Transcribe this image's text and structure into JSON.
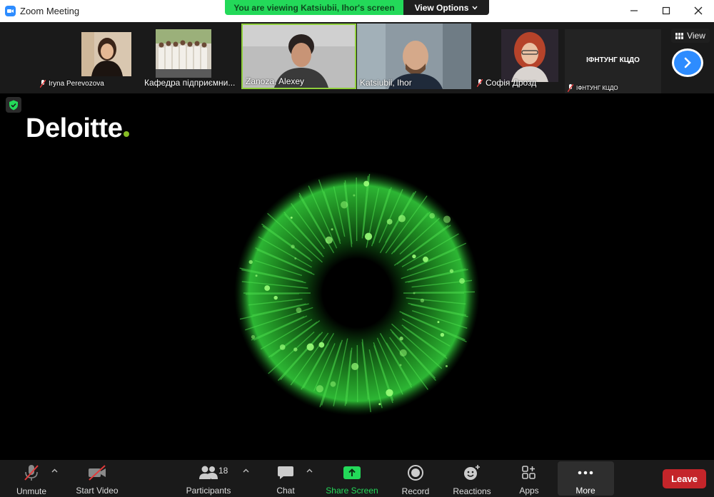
{
  "window": {
    "title": "Zoom Meeting"
  },
  "banner": {
    "text": "You are viewing Katsiubii, Ihor's screen",
    "view_options": "View Options"
  },
  "participants_strip": [
    {
      "name": "Iryna Perevozova",
      "muted": true
    },
    {
      "name": "Кафедра підприємни...",
      "muted": false
    },
    {
      "name": "Zanoza, Alexey",
      "muted": false,
      "active": true
    },
    {
      "name": "Katsiubii, Ihor",
      "muted": false
    },
    {
      "name": "Софія Дрозд",
      "muted": true
    },
    {
      "name": "ІФНТУНГ КЦДО",
      "muted": true,
      "video_label": "ІФНТУНГ КЦДО"
    }
  ],
  "view_button": "View",
  "shared_screen": {
    "brand": "Deloitte"
  },
  "toolbar": {
    "unmute": "Unmute",
    "start_video": "Start Video",
    "participants": "Participants",
    "participants_count": "18",
    "chat": "Chat",
    "share_screen": "Share Screen",
    "record": "Record",
    "reactions": "Reactions",
    "apps": "Apps",
    "more": "More",
    "leave": "Leave"
  },
  "colors": {
    "accent": "#2d8cff",
    "share_green": "#23d959",
    "leave_red": "#c4252a",
    "deloitte_green": "#86bc25"
  }
}
